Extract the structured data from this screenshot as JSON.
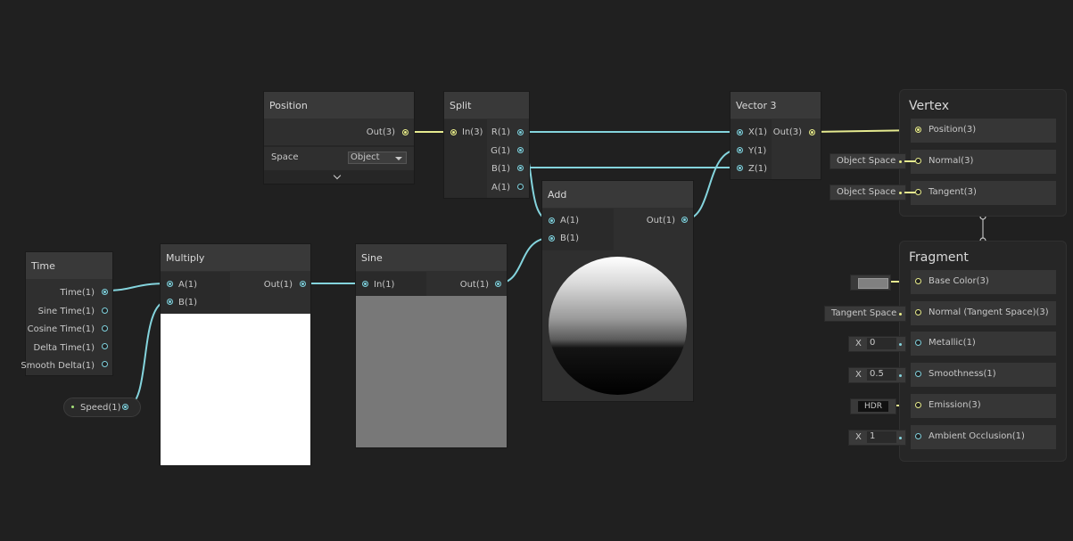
{
  "nodes": {
    "position": {
      "title": "Position",
      "out": "Out(3)",
      "space_label": "Space",
      "space_value": "Object"
    },
    "split": {
      "title": "Split",
      "in": "In(3)",
      "outs": [
        "R(1)",
        "G(1)",
        "B(1)",
        "A(1)"
      ]
    },
    "vector3": {
      "title": "Vector 3",
      "ins": [
        "X(1)",
        "Y(1)",
        "Z(1)"
      ],
      "out": "Out(3)"
    },
    "time": {
      "title": "Time",
      "outs": [
        "Time(1)",
        "Sine Time(1)",
        "Cosine Time(1)",
        "Delta Time(1)",
        "Smooth Delta(1)"
      ]
    },
    "multiply": {
      "title": "Multiply",
      "ins": [
        "A(1)",
        "B(1)"
      ],
      "out": "Out(1)"
    },
    "sine": {
      "title": "Sine",
      "in": "In(1)",
      "out": "Out(1)"
    },
    "add": {
      "title": "Add",
      "ins": [
        "A(1)",
        "B(1)"
      ],
      "out": "Out(1)"
    },
    "speed": {
      "label": "Speed(1)"
    }
  },
  "vertex": {
    "title": "Vertex",
    "slots": [
      {
        "label": "Position(3)"
      },
      {
        "label": "Normal(3)",
        "input": "Object Space"
      },
      {
        "label": "Tangent(3)",
        "input": "Object Space"
      }
    ]
  },
  "fragment": {
    "title": "Fragment",
    "slots": [
      {
        "label": "Base Color(3)"
      },
      {
        "label": "Normal (Tangent Space)(3)",
        "input": "Tangent Space"
      },
      {
        "label": "Metallic(1)",
        "axis": "X",
        "value": "0"
      },
      {
        "label": "Smoothness(1)",
        "axis": "X",
        "value": "0.5"
      },
      {
        "label": "Emission(3)",
        "input": "HDR"
      },
      {
        "label": "Ambient Occlusion(1)",
        "axis": "X",
        "value": "1"
      }
    ]
  },
  "colors": {
    "float_wire": "#84d4dd",
    "vector3_wire": "#e5ea8f",
    "background": "#202020",
    "node_body": "#2f2f2f",
    "node_header": "#393939",
    "base_color_swatch": "#808080"
  }
}
